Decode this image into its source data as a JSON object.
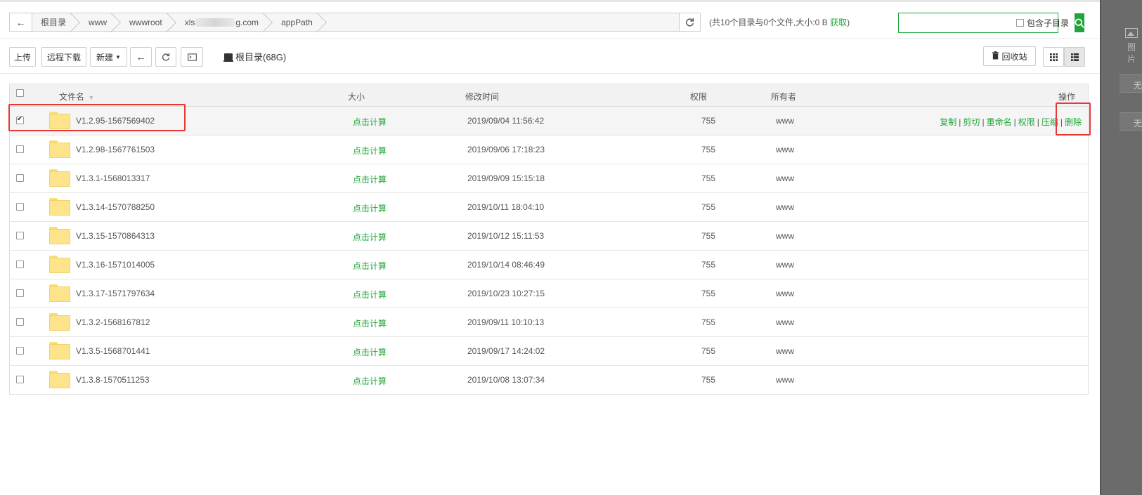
{
  "breadcrumb": {
    "back_icon": "arrow-left-icon",
    "items": [
      "根目录",
      "www",
      "wwwroot",
      "xls",
      "g.com",
      "appPath"
    ],
    "refresh_icon": "refresh-icon"
  },
  "summary": {
    "text": "(共10个目录与0个文件,大小:0 B",
    "link": "获取",
    "close": ")"
  },
  "search": {
    "value": "",
    "placeholder": "",
    "include_subdir_label": "包含子目录",
    "search_icon": "search-icon"
  },
  "toolbar": {
    "upload": "上传",
    "remote_download": "远程下载",
    "new": "新建",
    "disk_label": "根目录(68G)",
    "recycle_bin": "回收站"
  },
  "table": {
    "headers": {
      "name": "文件名",
      "size": "大小",
      "modified": "修改时间",
      "permission": "权限",
      "owner": "所有者",
      "actions": "操作"
    },
    "rows": [
      {
        "name": "V1.2.95-1567569402",
        "size": "点击计算",
        "modified": "2019/09/04 11:56:42",
        "permission": "755",
        "owner": "www",
        "selected": true
      },
      {
        "name": "V1.2.98-1567761503",
        "size": "点击计算",
        "modified": "2019/09/06 17:18:23",
        "permission": "755",
        "owner": "www",
        "selected": false
      },
      {
        "name": "V1.3.1-1568013317",
        "size": "点击计算",
        "modified": "2019/09/09 15:15:18",
        "permission": "755",
        "owner": "www",
        "selected": false
      },
      {
        "name": "V1.3.14-1570788250",
        "size": "点击计算",
        "modified": "2019/10/11 18:04:10",
        "permission": "755",
        "owner": "www",
        "selected": false
      },
      {
        "name": "V1.3.15-1570864313",
        "size": "点击计算",
        "modified": "2019/10/12 15:11:53",
        "permission": "755",
        "owner": "www",
        "selected": false
      },
      {
        "name": "V1.3.16-1571014005",
        "size": "点击计算",
        "modified": "2019/10/14 08:46:49",
        "permission": "755",
        "owner": "www",
        "selected": false
      },
      {
        "name": "V1.3.17-1571797634",
        "size": "点击计算",
        "modified": "2019/10/23 10:27:15",
        "permission": "755",
        "owner": "www",
        "selected": false
      },
      {
        "name": "V1.3.2-1568167812",
        "size": "点击计算",
        "modified": "2019/09/11 10:10:13",
        "permission": "755",
        "owner": "www",
        "selected": false
      },
      {
        "name": "V1.3.5-1568701441",
        "size": "点击计算",
        "modified": "2019/09/17 14:24:02",
        "permission": "755",
        "owner": "www",
        "selected": false
      },
      {
        "name": "V1.3.8-1570511253",
        "size": "点击计算",
        "modified": "2019/10/08 13:07:34",
        "permission": "755",
        "owner": "www",
        "selected": false
      }
    ],
    "row_actions": [
      "复制",
      "剪切",
      "重命名",
      "权限",
      "压缩",
      "删除"
    ]
  },
  "side_panel": {
    "image_label": "图片",
    "row1": "无",
    "row2": "无"
  },
  "colors": {
    "accent": "#20a53a",
    "highlight": "#e53935",
    "folder": "#fde48a"
  }
}
